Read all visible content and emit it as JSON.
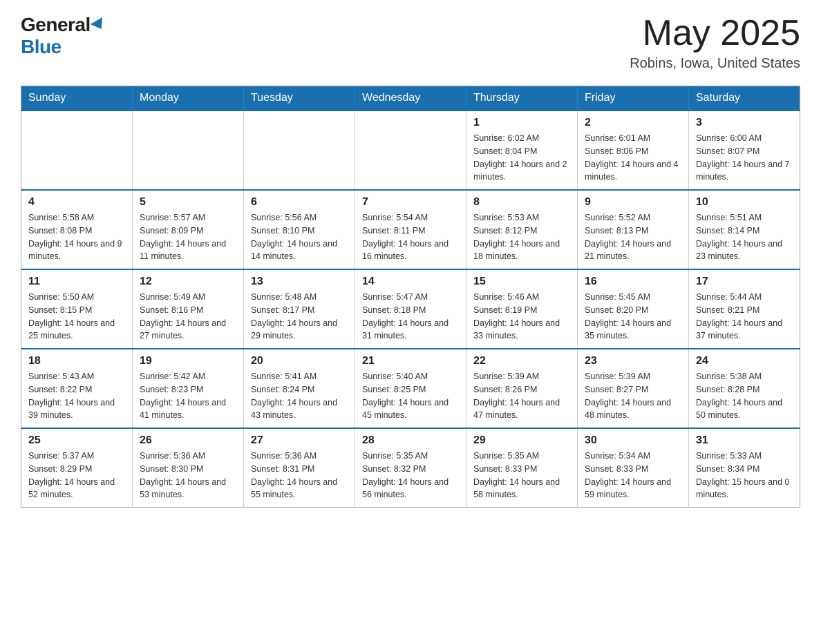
{
  "header": {
    "logo_general": "General",
    "logo_blue": "Blue",
    "month_title": "May 2025",
    "location": "Robins, Iowa, United States"
  },
  "calendar": {
    "days_of_week": [
      "Sunday",
      "Monday",
      "Tuesday",
      "Wednesday",
      "Thursday",
      "Friday",
      "Saturday"
    ],
    "weeks": [
      [
        {
          "day": "",
          "info": ""
        },
        {
          "day": "",
          "info": ""
        },
        {
          "day": "",
          "info": ""
        },
        {
          "day": "",
          "info": ""
        },
        {
          "day": "1",
          "info": "Sunrise: 6:02 AM\nSunset: 8:04 PM\nDaylight: 14 hours and 2 minutes."
        },
        {
          "day": "2",
          "info": "Sunrise: 6:01 AM\nSunset: 8:06 PM\nDaylight: 14 hours and 4 minutes."
        },
        {
          "day": "3",
          "info": "Sunrise: 6:00 AM\nSunset: 8:07 PM\nDaylight: 14 hours and 7 minutes."
        }
      ],
      [
        {
          "day": "4",
          "info": "Sunrise: 5:58 AM\nSunset: 8:08 PM\nDaylight: 14 hours and 9 minutes."
        },
        {
          "day": "5",
          "info": "Sunrise: 5:57 AM\nSunset: 8:09 PM\nDaylight: 14 hours and 11 minutes."
        },
        {
          "day": "6",
          "info": "Sunrise: 5:56 AM\nSunset: 8:10 PM\nDaylight: 14 hours and 14 minutes."
        },
        {
          "day": "7",
          "info": "Sunrise: 5:54 AM\nSunset: 8:11 PM\nDaylight: 14 hours and 16 minutes."
        },
        {
          "day": "8",
          "info": "Sunrise: 5:53 AM\nSunset: 8:12 PM\nDaylight: 14 hours and 18 minutes."
        },
        {
          "day": "9",
          "info": "Sunrise: 5:52 AM\nSunset: 8:13 PM\nDaylight: 14 hours and 21 minutes."
        },
        {
          "day": "10",
          "info": "Sunrise: 5:51 AM\nSunset: 8:14 PM\nDaylight: 14 hours and 23 minutes."
        }
      ],
      [
        {
          "day": "11",
          "info": "Sunrise: 5:50 AM\nSunset: 8:15 PM\nDaylight: 14 hours and 25 minutes."
        },
        {
          "day": "12",
          "info": "Sunrise: 5:49 AM\nSunset: 8:16 PM\nDaylight: 14 hours and 27 minutes."
        },
        {
          "day": "13",
          "info": "Sunrise: 5:48 AM\nSunset: 8:17 PM\nDaylight: 14 hours and 29 minutes."
        },
        {
          "day": "14",
          "info": "Sunrise: 5:47 AM\nSunset: 8:18 PM\nDaylight: 14 hours and 31 minutes."
        },
        {
          "day": "15",
          "info": "Sunrise: 5:46 AM\nSunset: 8:19 PM\nDaylight: 14 hours and 33 minutes."
        },
        {
          "day": "16",
          "info": "Sunrise: 5:45 AM\nSunset: 8:20 PM\nDaylight: 14 hours and 35 minutes."
        },
        {
          "day": "17",
          "info": "Sunrise: 5:44 AM\nSunset: 8:21 PM\nDaylight: 14 hours and 37 minutes."
        }
      ],
      [
        {
          "day": "18",
          "info": "Sunrise: 5:43 AM\nSunset: 8:22 PM\nDaylight: 14 hours and 39 minutes."
        },
        {
          "day": "19",
          "info": "Sunrise: 5:42 AM\nSunset: 8:23 PM\nDaylight: 14 hours and 41 minutes."
        },
        {
          "day": "20",
          "info": "Sunrise: 5:41 AM\nSunset: 8:24 PM\nDaylight: 14 hours and 43 minutes."
        },
        {
          "day": "21",
          "info": "Sunrise: 5:40 AM\nSunset: 8:25 PM\nDaylight: 14 hours and 45 minutes."
        },
        {
          "day": "22",
          "info": "Sunrise: 5:39 AM\nSunset: 8:26 PM\nDaylight: 14 hours and 47 minutes."
        },
        {
          "day": "23",
          "info": "Sunrise: 5:39 AM\nSunset: 8:27 PM\nDaylight: 14 hours and 48 minutes."
        },
        {
          "day": "24",
          "info": "Sunrise: 5:38 AM\nSunset: 8:28 PM\nDaylight: 14 hours and 50 minutes."
        }
      ],
      [
        {
          "day": "25",
          "info": "Sunrise: 5:37 AM\nSunset: 8:29 PM\nDaylight: 14 hours and 52 minutes."
        },
        {
          "day": "26",
          "info": "Sunrise: 5:36 AM\nSunset: 8:30 PM\nDaylight: 14 hours and 53 minutes."
        },
        {
          "day": "27",
          "info": "Sunrise: 5:36 AM\nSunset: 8:31 PM\nDaylight: 14 hours and 55 minutes."
        },
        {
          "day": "28",
          "info": "Sunrise: 5:35 AM\nSunset: 8:32 PM\nDaylight: 14 hours and 56 minutes."
        },
        {
          "day": "29",
          "info": "Sunrise: 5:35 AM\nSunset: 8:33 PM\nDaylight: 14 hours and 58 minutes."
        },
        {
          "day": "30",
          "info": "Sunrise: 5:34 AM\nSunset: 8:33 PM\nDaylight: 14 hours and 59 minutes."
        },
        {
          "day": "31",
          "info": "Sunrise: 5:33 AM\nSunset: 8:34 PM\nDaylight: 15 hours and 0 minutes."
        }
      ]
    ]
  }
}
